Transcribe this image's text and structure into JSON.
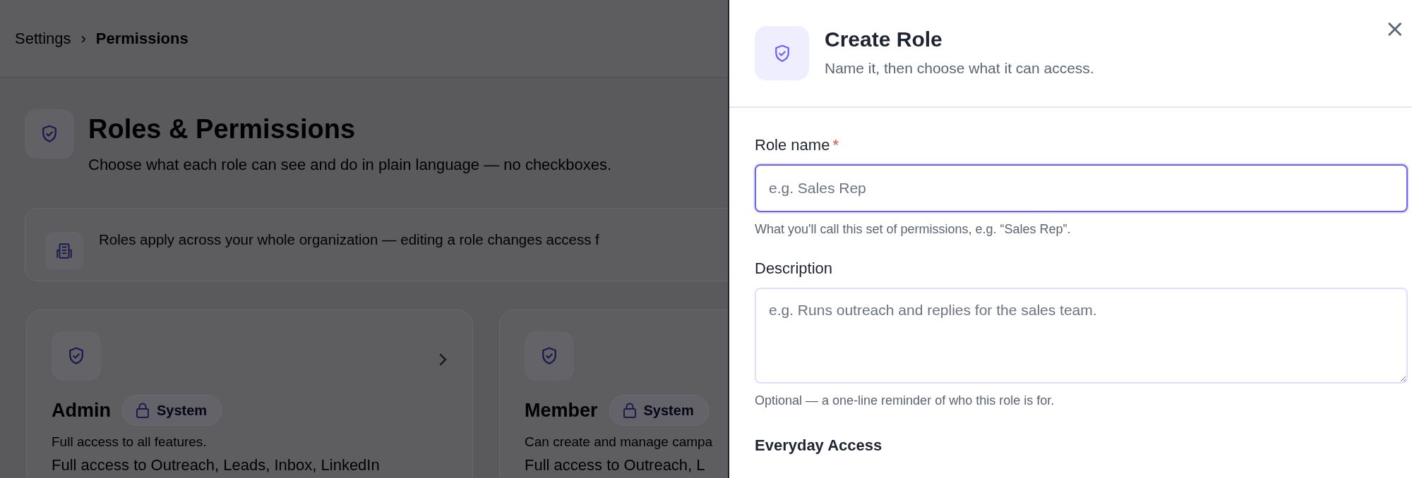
{
  "breadcrumb": {
    "parent": "Settings",
    "separator": "›",
    "current": "Permissions"
  },
  "page": {
    "title": "Roles & Permissions",
    "subtitle": "Choose what each role can see and do in plain language — no checkboxes."
  },
  "notice": {
    "text": "Roles apply across your whole organization — editing a role changes access f"
  },
  "roles": [
    {
      "name": "Admin",
      "badge": "System",
      "summary": "Full access to all features.",
      "details": "Full access to Outreach, Leads, Inbox, LinkedIn"
    },
    {
      "name": "Member",
      "badge": "System",
      "summary": "Can create and manage campa",
      "details": "Full access to Outreach, L"
    }
  ],
  "drawer": {
    "title": "Create Role",
    "subtitle": "Name it, then choose what it can access.",
    "close": "×",
    "fields": [
      {
        "kind": "input",
        "label": "Role name",
        "required": true,
        "placeholder": "e.g. Sales Rep",
        "help": "What you'll call this set of permissions, e.g. “Sales Rep”.",
        "focused": true
      },
      {
        "kind": "textarea",
        "label": "Description",
        "required": false,
        "placeholder": "e.g. Runs outreach and replies for the sales team.",
        "help": "Optional — a one-line reminder of who this role is for.",
        "focused": false
      }
    ],
    "required_mark": "*",
    "section_title": "Everyday Access"
  }
}
